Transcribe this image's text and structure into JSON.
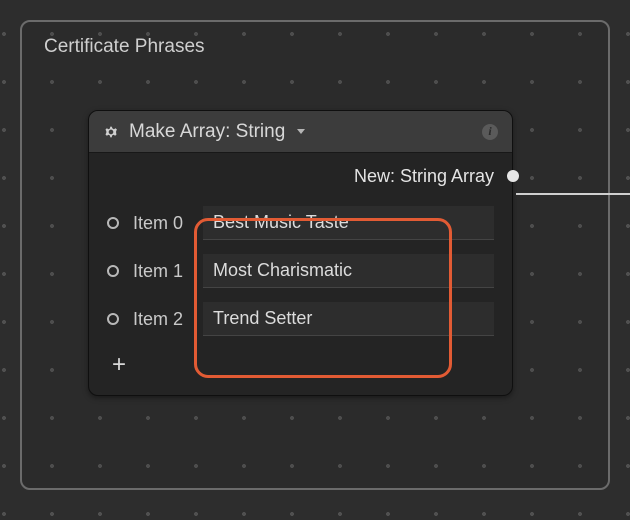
{
  "panel": {
    "title": "Certificate Phrases"
  },
  "node": {
    "title": "Make Array: String",
    "output_label": "New: String Array",
    "items": [
      {
        "label": "Item 0",
        "value": "Best Music Taste"
      },
      {
        "label": "Item 1",
        "value": "Most Charismatic"
      },
      {
        "label": "Item 2",
        "value": "Trend Setter"
      }
    ],
    "add_label": "+",
    "info_label": "i"
  }
}
